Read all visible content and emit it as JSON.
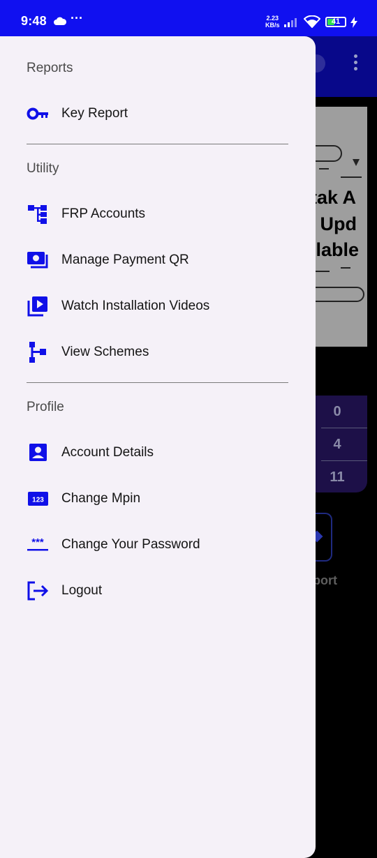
{
  "status_bar": {
    "time": "9:48",
    "overflow": "···",
    "net_speed_value": "2.23",
    "net_speed_unit": "KB/s",
    "battery_level": "41",
    "battery_fraction": 0.41
  },
  "background": {
    "banner_lines": [
      "atak A",
      "w Upd",
      "ailable"
    ],
    "stats": [
      "0",
      "4",
      "11"
    ],
    "tile_label": "eport"
  },
  "drawer": {
    "sections": [
      {
        "title": "Reports",
        "items": [
          {
            "label": "Key Report",
            "icon": "key-icon"
          }
        ]
      },
      {
        "title": "Utility",
        "items": [
          {
            "label": "FRP Accounts",
            "icon": "hierarchy-icon"
          },
          {
            "label": "Manage Payment QR",
            "icon": "payment-icon"
          },
          {
            "label": "Watch Installation Videos",
            "icon": "video-library-icon"
          },
          {
            "label": "View Schemes",
            "icon": "tree-icon"
          }
        ]
      },
      {
        "title": "Profile",
        "items": [
          {
            "label": "Account Details",
            "icon": "account-box-icon"
          },
          {
            "label": "Change Mpin",
            "icon": "pin-icon",
            "icon_text": "123"
          },
          {
            "label": "Change Your Password",
            "icon": "password-icon",
            "icon_text": "***"
          },
          {
            "label": "Logout",
            "icon": "logout-icon"
          }
        ]
      }
    ]
  },
  "colors": {
    "status_bar": "#1010f0",
    "app_bar": "#08088a",
    "drawer_bg": "#f5f1f8",
    "icon_blue": "#1010e8",
    "text": "#141414",
    "section_text": "#4a4a4a"
  }
}
